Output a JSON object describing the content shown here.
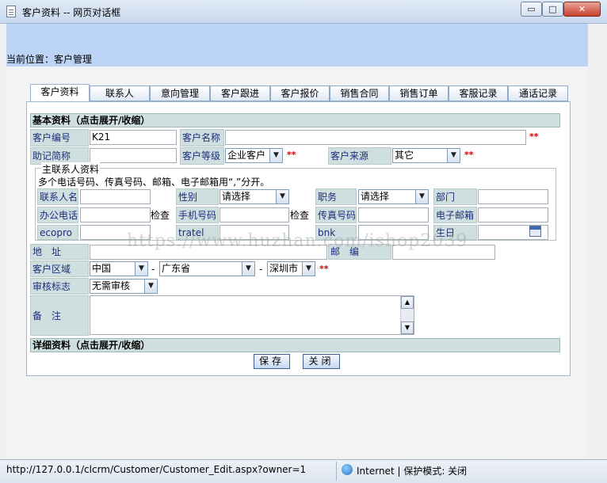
{
  "window": {
    "title": "客户资料 -- 网页对话框",
    "min_label": "▭",
    "max_label": "□",
    "close_label": "✕"
  },
  "location": "当前位置：客户管理",
  "tabs": [
    "客户资料",
    "联系人",
    "意向管理",
    "客户跟进",
    "客户报价",
    "销售合同",
    "销售订单",
    "客服记录",
    "通话记录"
  ],
  "sections": {
    "basic": "基本资料（点击展开/收缩）",
    "detail": "详细资料（点击展开/收缩）"
  },
  "form": {
    "customer_no_label": "客户编号",
    "customer_no_value": "K21",
    "customer_name_label": "客户名称",
    "customer_name_value": "",
    "required_mark": "**",
    "alias_label": "助记简称",
    "alias_value": "",
    "level_label": "客户等级",
    "level_value": "企业客户",
    "source_label": "客户来源",
    "source_value": "其它",
    "address_label": "地　址",
    "postcode_label": "邮　编",
    "region_label": "客户区域",
    "country_value": "中国",
    "province_value": "广东省",
    "city_value": "深圳市",
    "dash": "-",
    "audit_label": "审核标志",
    "audit_value": "无需审核",
    "remark_label": "备　注"
  },
  "contact": {
    "legend": "主联系人资料",
    "note": "多个电话号码、传真号码、邮箱、电子邮箱用“,”分开。",
    "name_label": "联系人名",
    "gender_label": "性别",
    "gender_value": "请选择",
    "duty_label": "职务",
    "duty_value": "请选择",
    "dept_label": "部门",
    "office_phone_label": "办公电话",
    "check_label": "检查",
    "mobile_label": "手机号码",
    "fax_label": "传真号码",
    "email_label": "电子邮箱",
    "ecopro_label": "ecopro",
    "tratel_label": "tratel",
    "bnk_label": "bnk",
    "birthday_label": "生日"
  },
  "buttons": {
    "save": "保存",
    "close": "关闭"
  },
  "watermark": "https://www.huzhan.com/ishop2039",
  "statusbar": {
    "url": "http://127.0.0.1/clcrm/Customer/Customer_Edit.aspx?owner=1",
    "zone": "Internet | 保护模式: 关闭"
  }
}
